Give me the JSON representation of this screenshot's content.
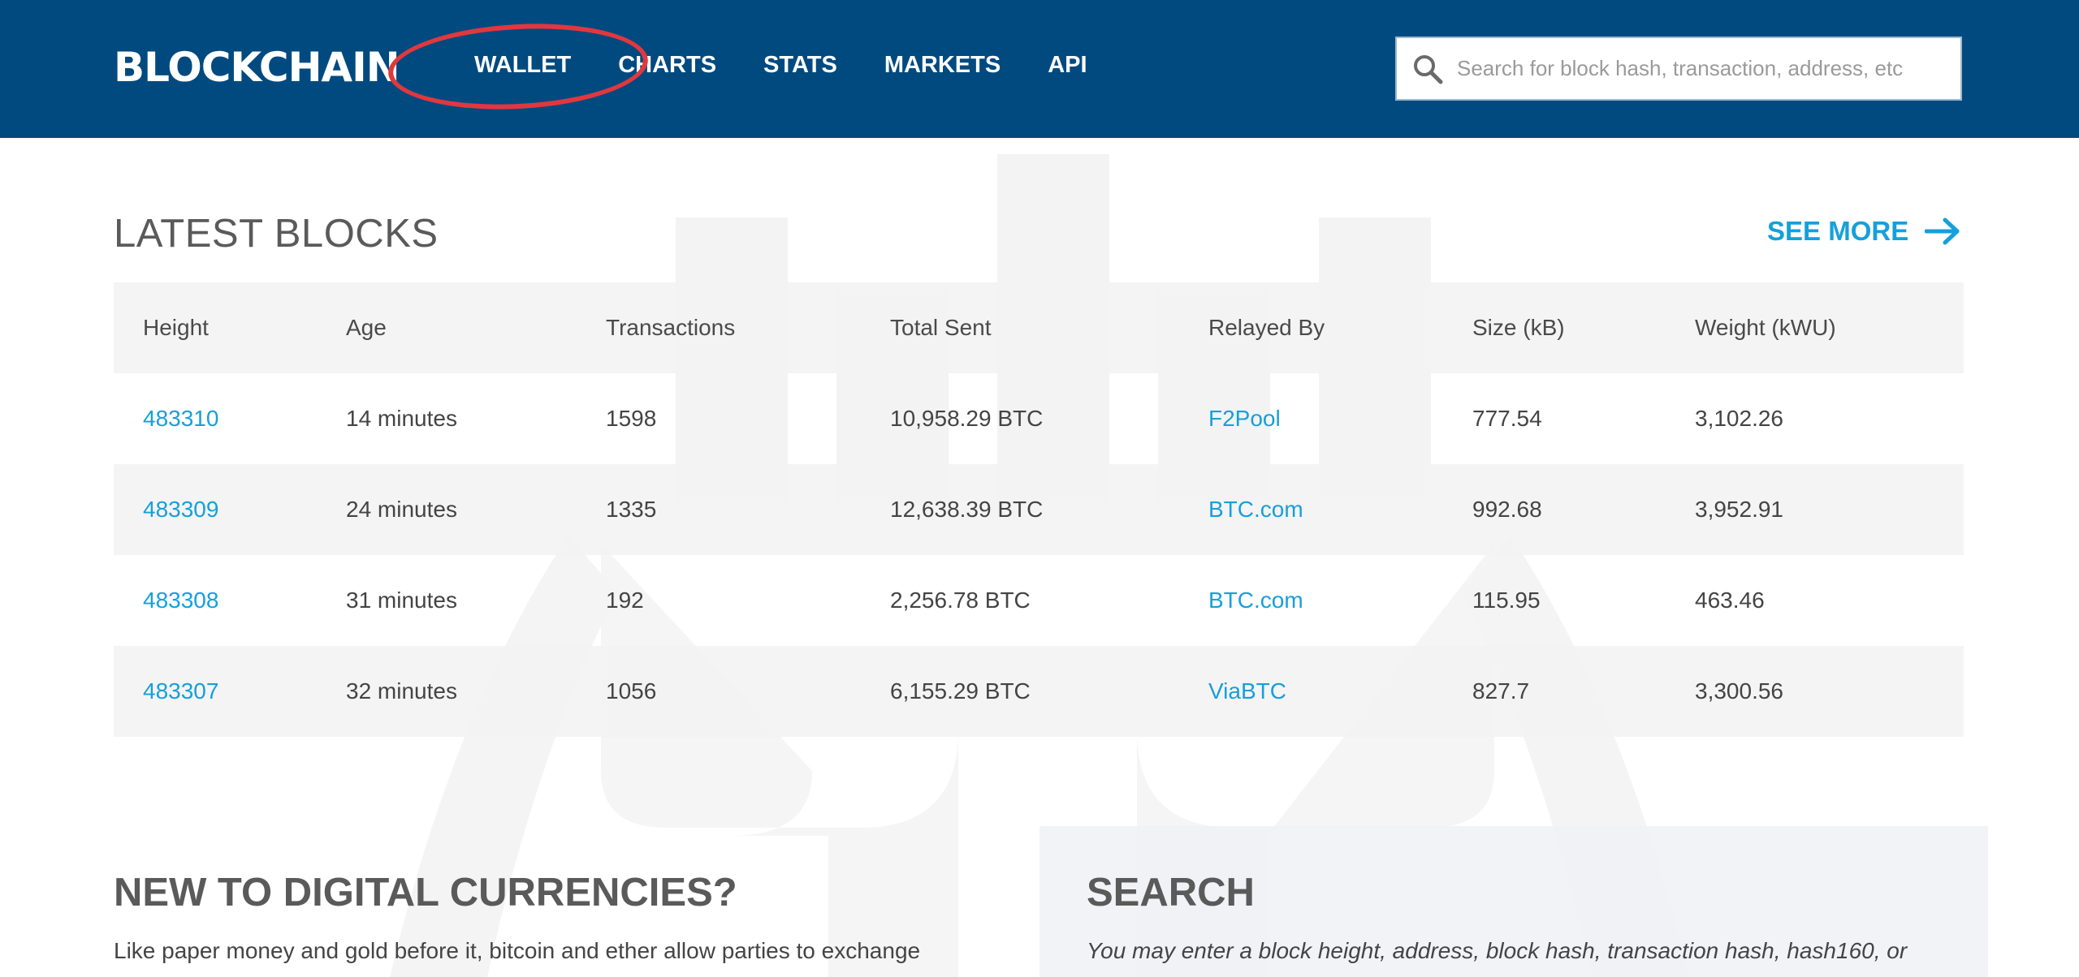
{
  "header": {
    "logo": "BLOCKCHAIN",
    "nav": [
      "WALLET",
      "CHARTS",
      "STATS",
      "MARKETS",
      "API"
    ],
    "search_placeholder": "Search for block hash, transaction, address, etc"
  },
  "latest_blocks": {
    "title": "LATEST BLOCKS",
    "see_more": "SEE MORE",
    "columns": [
      "Height",
      "Age",
      "Transactions",
      "Total Sent",
      "Relayed By",
      "Size (kB)",
      "Weight (kWU)"
    ],
    "rows": [
      [
        "483310",
        "14 minutes",
        "1598",
        "10,958.29 BTC",
        "F2Pool",
        "777.54",
        "3,102.26"
      ],
      [
        "483309",
        "24 minutes",
        "1335",
        "12,638.39 BTC",
        "BTC.com",
        "992.68",
        "3,952.91"
      ],
      [
        "483308",
        "31 minutes",
        "192",
        "2,256.78 BTC",
        "BTC.com",
        "115.95",
        "463.46"
      ],
      [
        "483307",
        "32 minutes",
        "1056",
        "6,155.29 BTC",
        "ViaBTC",
        "827.7",
        "3,300.56"
      ]
    ]
  },
  "new_to_digital": {
    "title": "NEW TO DIGITAL CURRENCIES?",
    "text": "Like paper money and gold before it, bitcoin and ether allow parties to exchange"
  },
  "search_section": {
    "title": "SEARCH",
    "text": "You may enter a block height, address, block hash, transaction hash, hash160, or"
  },
  "colors": {
    "header_bg": "#004a80",
    "link": "#16a0db",
    "annotation": "#e0383e"
  }
}
